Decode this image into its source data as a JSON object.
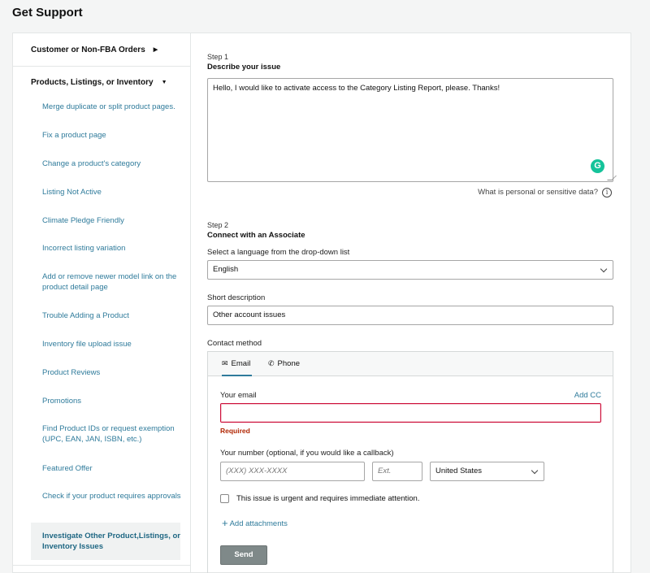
{
  "page": {
    "title": "Get Support"
  },
  "sidebar": {
    "section1": {
      "label": "Customer or Non-FBA Orders",
      "arrow": "▶"
    },
    "section2": {
      "label": "Products, Listings, or Inventory",
      "arrow": "▼"
    },
    "items": [
      {
        "label": "Merge duplicate or split product pages."
      },
      {
        "label": "Fix a product page"
      },
      {
        "label": "Change a product's category"
      },
      {
        "label": "Listing Not Active"
      },
      {
        "label": "Climate Pledge Friendly"
      },
      {
        "label": "Incorrect listing variation"
      },
      {
        "label": "Add or remove newer model link on the product detail page"
      },
      {
        "label": "Trouble Adding a Product"
      },
      {
        "label": "Inventory file upload issue"
      },
      {
        "label": "Product Reviews"
      },
      {
        "label": "Promotions"
      },
      {
        "label": "Find Product IDs or request exemption (UPC, EAN, JAN, ISBN, etc.)"
      },
      {
        "label": "Featured Offer"
      },
      {
        "label": "Check if your product requires approvals"
      },
      {
        "label": "Investigate Other Product,Listings, or Inventory Issues"
      }
    ]
  },
  "step1": {
    "label": "Step 1",
    "title": "Describe your issue",
    "text": "Hello, I would like to activate access to the Category Listing Report, please. Thanks!",
    "grammarly_letter": "G",
    "sensitive_link": "What is personal or sensitive data?",
    "info_glyph": "i"
  },
  "step2": {
    "label": "Step 2",
    "title": "Connect with an Associate",
    "language_label": "Select a language from the drop-down list",
    "language_value": "English",
    "short_desc_label": "Short description",
    "short_desc_value": "Other account issues",
    "contact_label": "Contact method"
  },
  "contact": {
    "tabs": [
      {
        "label": "Email",
        "icon": "✉"
      },
      {
        "label": "Phone",
        "icon": "✆"
      }
    ],
    "email_label": "Your email",
    "add_cc": "Add CC",
    "email_value": "",
    "required": "Required",
    "number_label": "Your number (optional, if you would like a callback)",
    "number_placeholder": "(XXX) XXX-XXXX",
    "ext_placeholder": "Ext.",
    "country_value": "United States",
    "urgent_label": "This issue is urgent and requires immediate attention.",
    "attach_label": "Add attachments",
    "send_label": "Send"
  }
}
